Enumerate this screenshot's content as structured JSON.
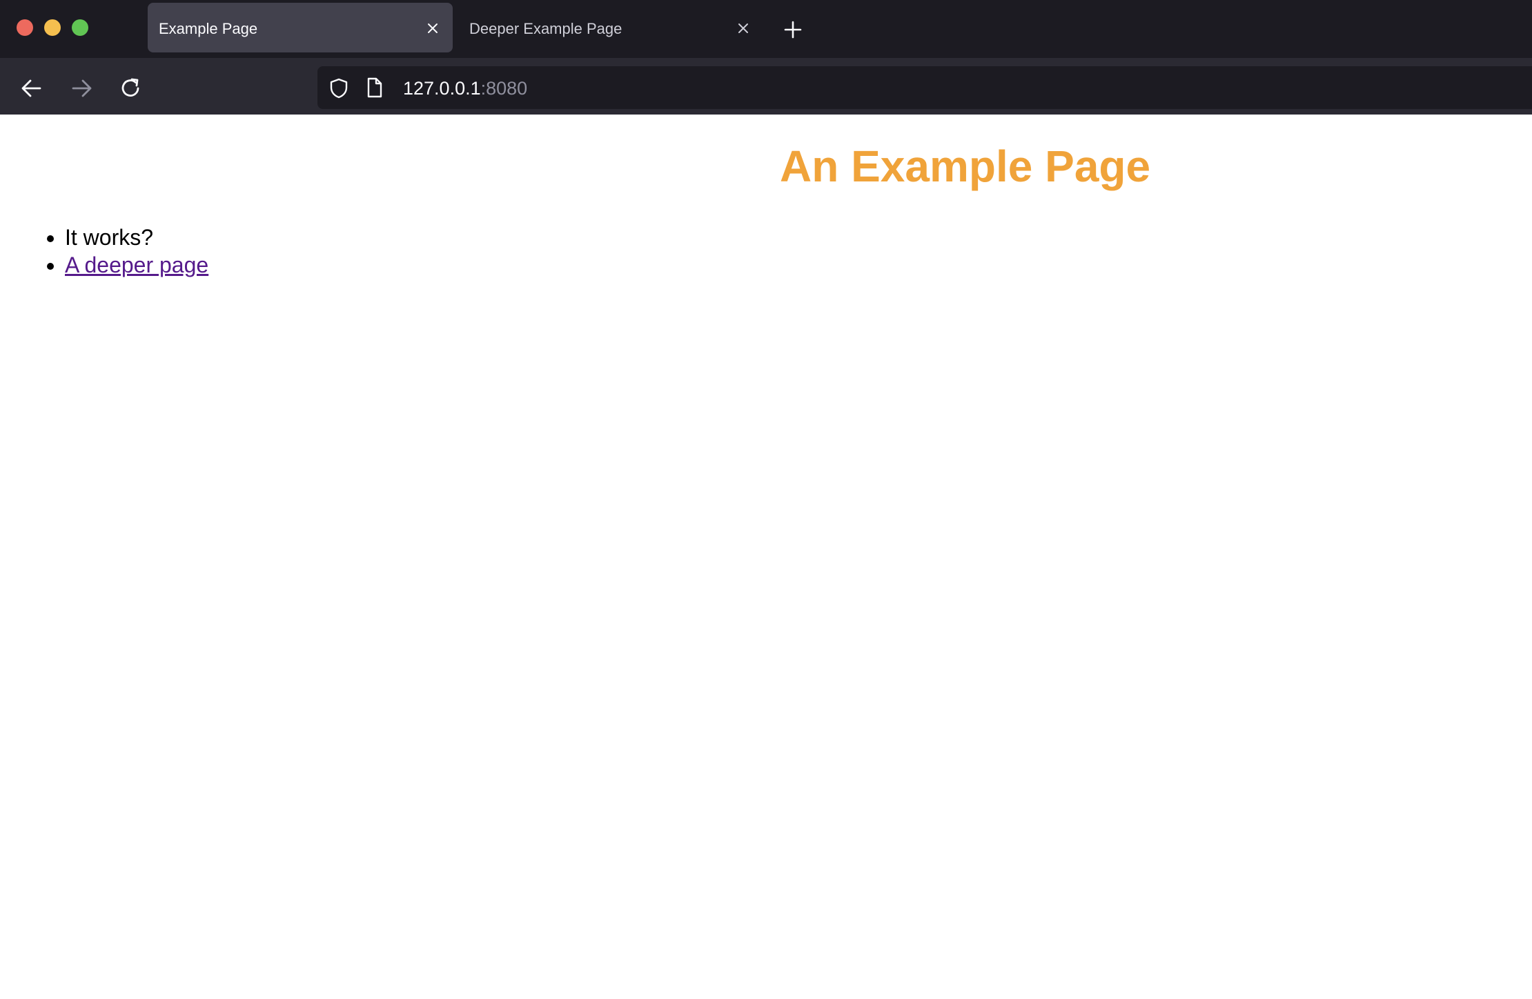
{
  "browser": {
    "tabs": [
      {
        "title": "Example Page",
        "active": true
      },
      {
        "title": "Deeper Example Page",
        "active": false
      }
    ],
    "url": {
      "host": "127.0.0.1",
      "port": ":8080"
    },
    "colors": {
      "tabstrip_bg": "#1c1b22",
      "toolbar_bg": "#2b2a33",
      "active_tab_bg": "#42414d",
      "close_dot": "#ed6a5e",
      "minimize_dot": "#f5bf4f",
      "maximize_dot": "#61c554"
    },
    "icons": {
      "back": "arrow-left-icon",
      "forward": "arrow-right-icon",
      "reload": "reload-icon",
      "shield": "shield-icon",
      "page": "page-icon",
      "tab_close": "close-icon",
      "new_tab": "plus-icon"
    }
  },
  "page": {
    "heading": "An Example Page",
    "heading_color": "#f0a33a",
    "items": [
      {
        "text": "It works?"
      },
      {
        "text": "A deeper page",
        "link_color": "#551a8b"
      }
    ]
  }
}
